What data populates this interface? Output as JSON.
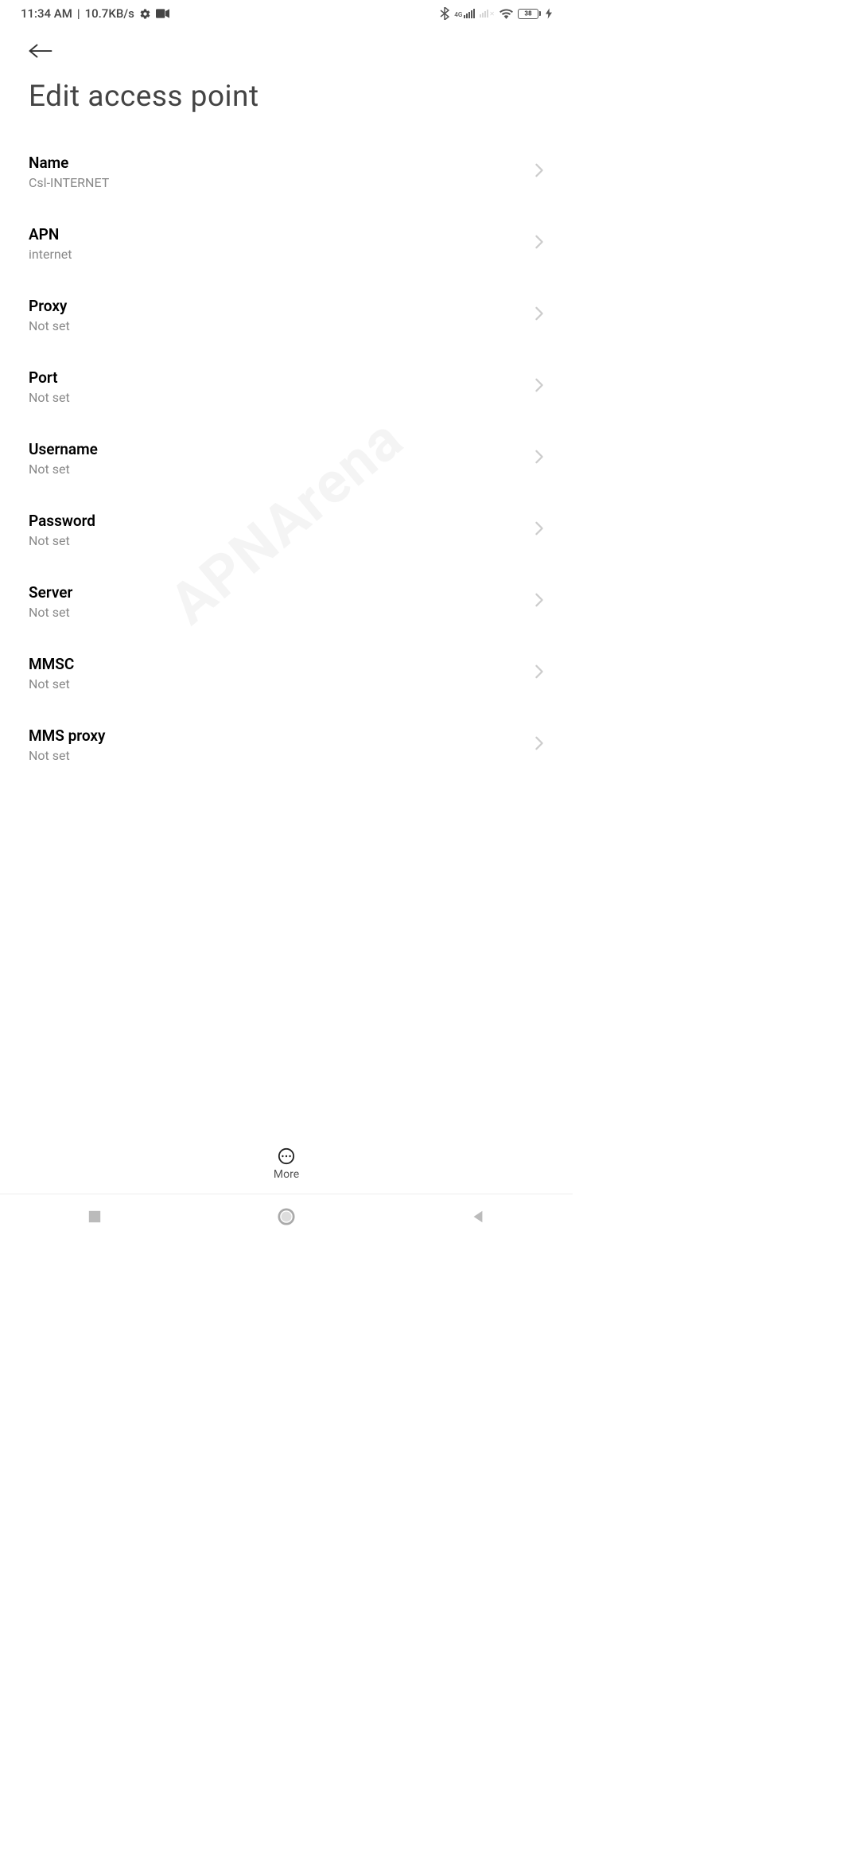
{
  "status": {
    "time": "11:34 AM",
    "speed": "10.7KB/s",
    "network_label": "4G",
    "battery_pct": "38"
  },
  "page_title": "Edit access point",
  "fields": [
    {
      "label": "Name",
      "value": "Csl-INTERNET"
    },
    {
      "label": "APN",
      "value": "internet"
    },
    {
      "label": "Proxy",
      "value": "Not set"
    },
    {
      "label": "Port",
      "value": "Not set"
    },
    {
      "label": "Username",
      "value": "Not set"
    },
    {
      "label": "Password",
      "value": "Not set"
    },
    {
      "label": "Server",
      "value": "Not set"
    },
    {
      "label": "MMSC",
      "value": "Not set"
    },
    {
      "label": "MMS proxy",
      "value": "Not set"
    }
  ],
  "bottom_tool": {
    "label": "More"
  },
  "watermark": "APNArena"
}
